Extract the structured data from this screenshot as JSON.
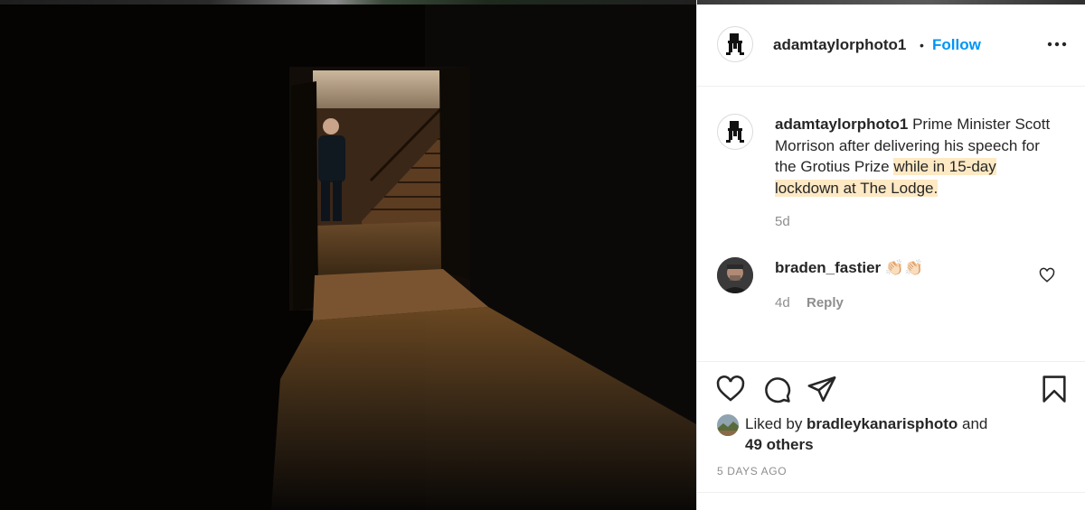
{
  "post": {
    "username": "adamtaylorphoto1",
    "separator": "•",
    "follow_label": "Follow",
    "more_icon": "more-dots-icon",
    "caption_plain": "Prime Minister Scott Morrison after delivering his speech for the Grotius Prize ",
    "caption_highlight": "while in 15-day lockdown at The Lodge.",
    "caption_age": "5d"
  },
  "comment": {
    "username": "braden_fastier",
    "emoji": "👏🏻👏🏻",
    "age": "4d",
    "reply_label": "Reply",
    "like_icon": "heart-outline-icon"
  },
  "actions": {
    "like_icon": "heart-icon",
    "comment_icon": "comment-bubble-icon",
    "share_icon": "paper-plane-icon",
    "save_icon": "bookmark-icon"
  },
  "likes": {
    "prefix": "Liked by ",
    "user": "bradleykanarisphoto",
    "joiner": " and",
    "others": "49 others"
  },
  "posted": "5 DAYS AGO",
  "colors": {
    "accent": "#0095f6",
    "highlight": "#fde9c4",
    "text": "#262626",
    "muted": "#8e8e8e"
  }
}
